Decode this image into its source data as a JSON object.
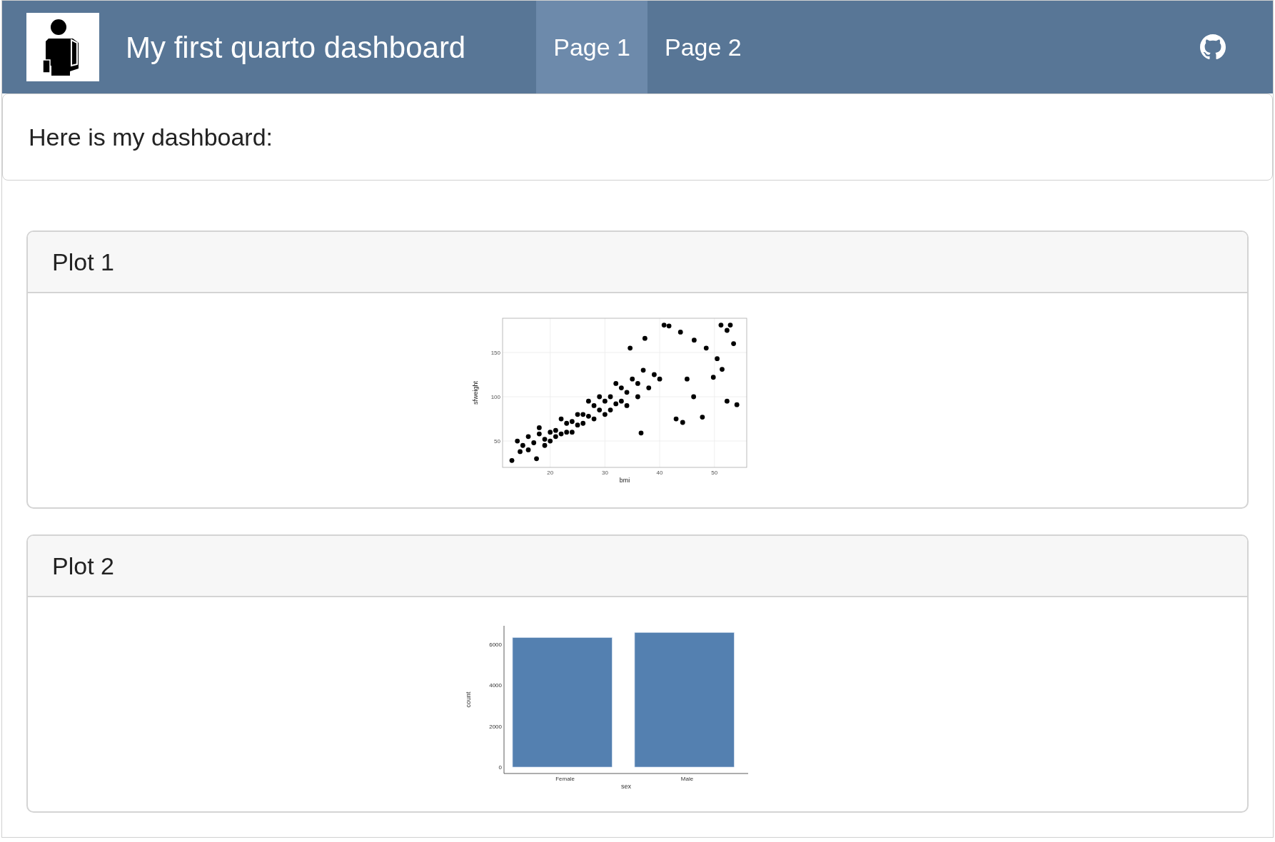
{
  "navbar": {
    "title": "My first quarto dashboard",
    "tabs": [
      {
        "label": "Page 1",
        "selected": true
      },
      {
        "label": "Page 2",
        "selected": false
      }
    ]
  },
  "intro": {
    "text": "Here is my dashboard:"
  },
  "cards": [
    {
      "title": "Plot 1",
      "chart_data": {
        "type": "scatter",
        "xlabel": "bmi",
        "ylabel": "sfweight",
        "xlim": [
          11.3,
          55.9
        ],
        "ylim": [
          20.2,
          188.7
        ],
        "xticks": [
          20,
          30,
          40,
          50
        ],
        "yticks": [
          50,
          100,
          150
        ],
        "grid": true,
        "series": [
          {
            "color": "#000000",
            "x": [
              14,
              15,
              16,
              17,
              18,
              19,
              20,
              21,
              22,
              23,
              24,
              25,
              26,
              27,
              28,
              29,
              30,
              31,
              32,
              33,
              34,
              35,
              36,
              37,
              38,
              39,
              40,
              18,
              20,
              22,
              24,
              26,
              28,
              30,
              32,
              34,
              36,
              16,
              19,
              21,
              23,
              25,
              27,
              29,
              31,
              33,
              13,
              17.5,
              14.5,
              40.8,
              41.7,
              37.3,
              43.8,
              46.3,
              51.2,
              52.9,
              52.3,
              53.5,
              49.8,
              52.3,
              54.1,
              47.8,
              43,
              44.2,
              36.6,
              46.2,
              48.5,
              34.6,
              45,
              50.5,
              51.4
            ],
            "values": [
              50,
              45,
              55,
              48,
              58,
              52,
              60,
              62,
              58,
              70,
              72,
              68,
              80,
              78,
              90,
              85,
              95,
              100,
              92,
              110,
              105,
              120,
              115,
              130,
              110,
              125,
              120,
              65,
              50,
              75,
              60,
              70,
              75,
              80,
              115,
              90,
              100,
              40,
              45,
              55,
              60,
              80,
              95,
              100,
              85,
              95,
              28,
              30,
              38,
              181,
              180,
              166,
              173,
              164,
              181,
              181,
              175,
              160,
              122,
              95,
              91,
              77,
              75,
              71,
              59,
              100,
              155,
              155,
              120,
              143,
              131
            ]
          }
        ]
      }
    },
    {
      "title": "Plot 2",
      "chart_data": {
        "type": "bar",
        "xlabel": "sex",
        "ylabel": "count",
        "categories": [
          "Female",
          "Male"
        ],
        "ylim": [
          -314,
          6906
        ],
        "yticks": [
          0,
          2000,
          4000,
          6000
        ],
        "series": [
          {
            "color": "#5480b0",
            "values": [
              6330,
              6580
            ]
          }
        ]
      }
    }
  ]
}
